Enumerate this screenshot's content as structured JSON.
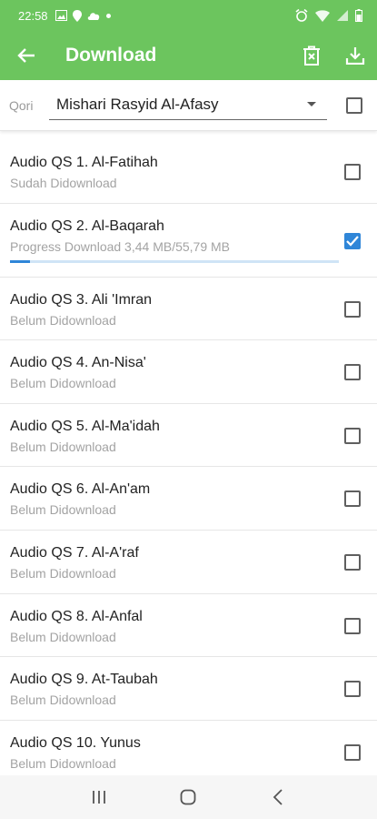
{
  "status_bar": {
    "time": "22:58",
    "left_icons": [
      "image-icon",
      "location-icon",
      "cloud-icon",
      "dot-icon"
    ],
    "right_icons": [
      "alarm-icon",
      "wifi-icon",
      "signal-icon",
      "battery-icon"
    ]
  },
  "app_bar": {
    "title": "Download",
    "back_icon": "arrow-left-icon",
    "actions": [
      "delete-icon",
      "download-icon"
    ]
  },
  "qori": {
    "label": "Qori",
    "selected": "Mishari Rasyid Al-Afasy"
  },
  "items": [
    {
      "name": "Audio QS 1. Al-Fatihah",
      "status": "Sudah Didownload",
      "checked": false
    },
    {
      "name": "Audio QS 2. Al-Baqarah",
      "status": "Progress Download 3,44 MB/55,79 MB",
      "checked": true,
      "progress": 0.062
    },
    {
      "name": "Audio QS 3. Ali 'Imran",
      "status": "Belum Didownload",
      "checked": false
    },
    {
      "name": "Audio QS 4. An-Nisa'",
      "status": "Belum Didownload",
      "checked": false
    },
    {
      "name": "Audio QS 5. Al-Ma'idah",
      "status": "Belum Didownload",
      "checked": false
    },
    {
      "name": "Audio QS 6. Al-An'am",
      "status": "Belum Didownload",
      "checked": false
    },
    {
      "name": "Audio QS 7. Al-A'raf",
      "status": "Belum Didownload",
      "checked": false
    },
    {
      "name": "Audio QS 8. Al-Anfal",
      "status": "Belum Didownload",
      "checked": false
    },
    {
      "name": "Audio QS 9. At-Taubah",
      "status": "Belum Didownload",
      "checked": false
    },
    {
      "name": "Audio QS 10. Yunus",
      "status": "Belum Didownload",
      "checked": false
    }
  ],
  "nav_bar": [
    "recent-apps-icon",
    "home-icon",
    "back-icon"
  ],
  "colors": {
    "primary": "#6cc55e",
    "accent": "#2f86d8"
  }
}
